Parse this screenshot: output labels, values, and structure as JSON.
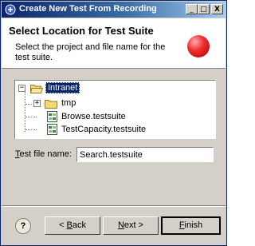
{
  "window": {
    "title": "Create New Test From Recording",
    "controls": {
      "minimize": "_",
      "maximize": "□",
      "close": "X"
    }
  },
  "header": {
    "title": "Select Location for Test Suite",
    "description": "Select the project and file name for the test suite.",
    "indicator_color": "#e02020"
  },
  "tree": {
    "items": [
      {
        "label": "Intranet",
        "type": "project",
        "icon": "open-folder-icon",
        "expanded": true,
        "selected": true
      },
      {
        "label": "tmp",
        "type": "folder",
        "icon": "folder-icon",
        "expanded": false
      },
      {
        "label": "Browse.testsuite",
        "type": "file",
        "icon": "testsuite-file-icon"
      },
      {
        "label": "TestCapacity.testsuite",
        "type": "file",
        "icon": "testsuite-file-icon"
      }
    ]
  },
  "file_name": {
    "label_mnemonic": "T",
    "label_rest": "est file name:",
    "value": "Search.testsuite"
  },
  "buttons": {
    "help": "?",
    "back_prefix": "< ",
    "back_mnemonic": "B",
    "back_rest": "ack",
    "next_mnemonic": "N",
    "next_rest": "ext >",
    "finish_mnemonic": "F",
    "finish_rest": "inish"
  },
  "colors": {
    "titlebar": "#0a246a",
    "selection": "#0a246a",
    "dialog_bg": "#d4d0c8"
  }
}
